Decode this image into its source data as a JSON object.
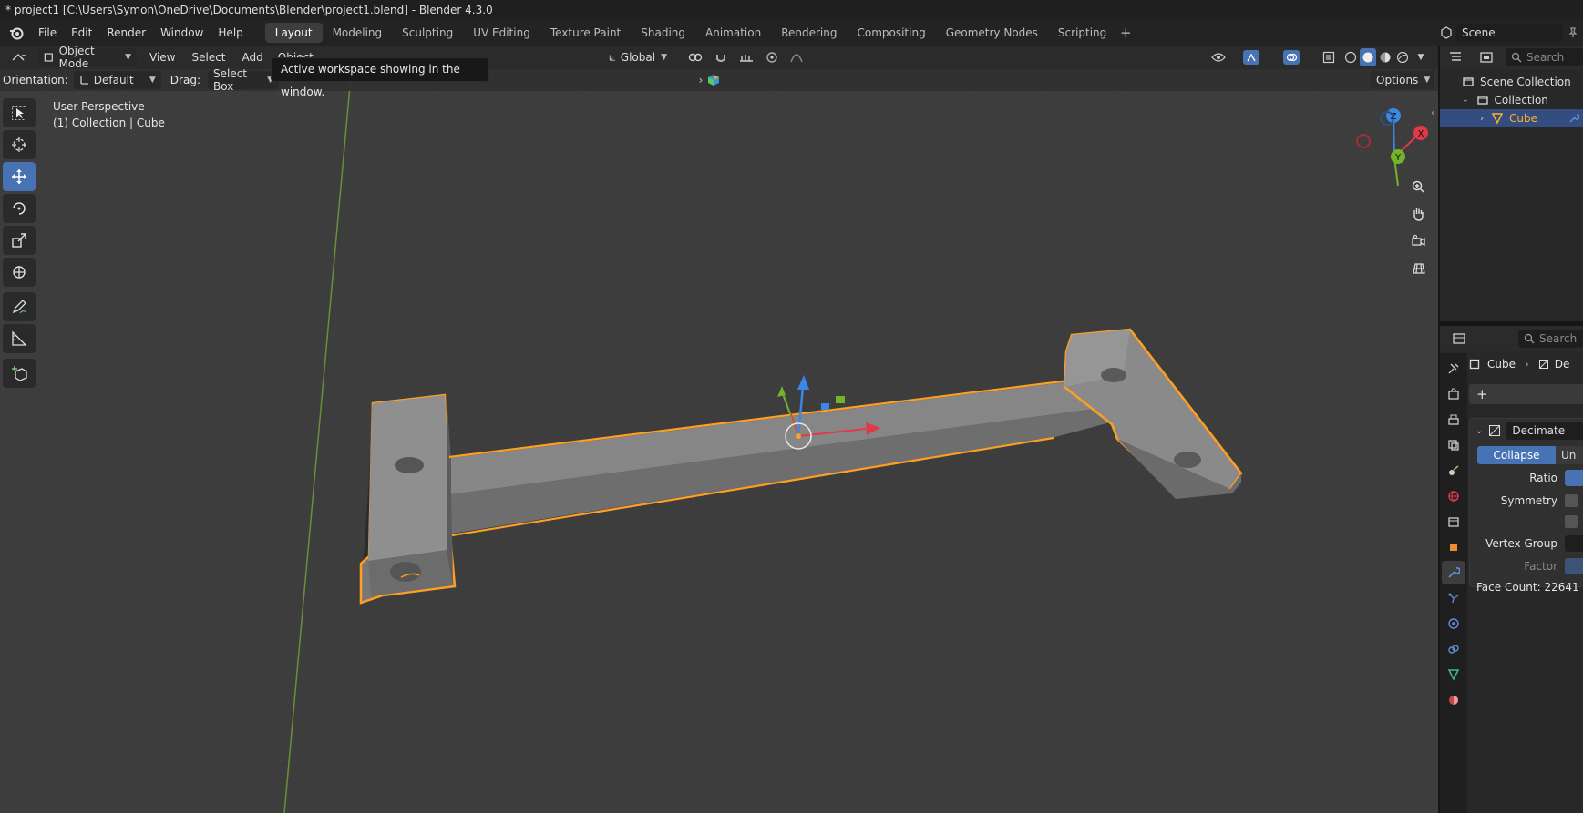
{
  "window": {
    "title": "* project1 [C:\\Users\\Symon\\OneDrive\\Documents\\Blender\\project1.blend] - Blender 4.3.0"
  },
  "menu": [
    "File",
    "Edit",
    "Render",
    "Window",
    "Help"
  ],
  "workspaces": [
    {
      "label": "Layout",
      "active": true
    },
    {
      "label": "Modeling"
    },
    {
      "label": "Sculpting"
    },
    {
      "label": "UV Editing"
    },
    {
      "label": "Texture Paint"
    },
    {
      "label": "Shading"
    },
    {
      "label": "Animation"
    },
    {
      "label": "Rendering"
    },
    {
      "label": "Compositing"
    },
    {
      "label": "Geometry Nodes"
    },
    {
      "label": "Scripting"
    }
  ],
  "scene": {
    "name": "Scene"
  },
  "viewport": {
    "mode": "Object Mode",
    "menus": [
      "View",
      "Select",
      "Add",
      "Object"
    ],
    "transform_orientation": "Global",
    "orientation_label": "Orientation:",
    "orientation_value": "Default",
    "drag_label": "Drag:",
    "drag_value": "Select Box",
    "options_label": "Options",
    "tooltip": "Active workspace showing in the window.",
    "perspective": "User Perspective",
    "collection_info": "(1) Collection | Cube",
    "gizmo_axes": {
      "x": "X",
      "y": "Y",
      "z": "Z"
    },
    "colors": {
      "background": "#3d3d3d",
      "selection": "#ff9f22",
      "axis_x": "#e2394a",
      "axis_y": "#71b32a",
      "axis_z": "#3d87e4"
    }
  },
  "outliner": {
    "search_placeholder": "Search",
    "rows": [
      {
        "label": "Scene Collection"
      },
      {
        "label": "Collection"
      },
      {
        "label": "Cube",
        "selected": true
      }
    ]
  },
  "properties": {
    "search_placeholder": "Search",
    "breadcrumb_object": "Cube",
    "breadcrumb_modifier": "De",
    "modifier_name": "Decimate",
    "mode_collapse": "Collapse",
    "mode_unsubdiv": "Un",
    "fields": {
      "ratio": "Ratio",
      "symmetry": "Symmetry",
      "vertex_group": "Vertex Group",
      "factor": "Factor"
    },
    "face_count": "Face Count: 22641"
  }
}
